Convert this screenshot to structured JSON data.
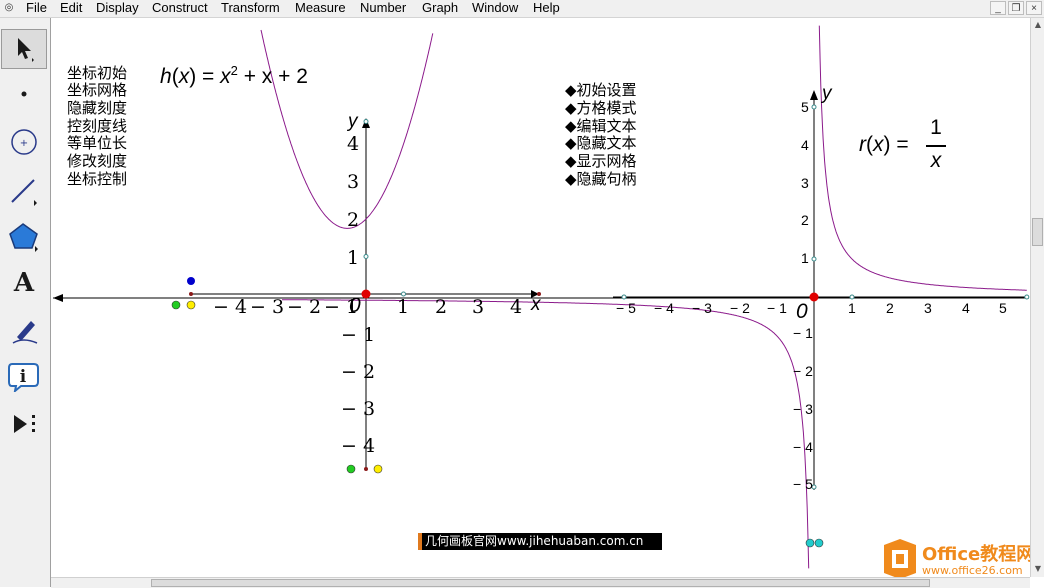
{
  "menu": {
    "items": [
      "File",
      "Edit",
      "Display",
      "Construct",
      "Transform",
      "Measure",
      "Number",
      "Graph",
      "Window",
      "Help"
    ],
    "window_controls": [
      "_",
      "❐",
      "×"
    ]
  },
  "toolbar": {
    "tools": [
      {
        "name": "arrow-select-tool",
        "icon": "arrow-icon",
        "active": true
      },
      {
        "name": "point-tool",
        "icon": "point-icon",
        "active": false
      },
      {
        "name": "compass-tool",
        "icon": "circle-icon",
        "active": false
      },
      {
        "name": "straightedge-tool",
        "icon": "line-icon",
        "active": false
      },
      {
        "name": "polygon-tool",
        "icon": "polygon-icon",
        "active": false
      },
      {
        "name": "text-tool",
        "icon": "text-icon",
        "active": false
      },
      {
        "name": "marker-tool",
        "icon": "pen-icon",
        "active": false
      },
      {
        "name": "information-tool",
        "icon": "info-icon",
        "active": false
      },
      {
        "name": "custom-tool",
        "icon": "custom-tools-icon",
        "active": false
      }
    ],
    "text_tool_glyph": "A"
  },
  "left_commands": [
    "坐标初始",
    "坐标网格",
    "隐藏刻度",
    "控刻度线",
    "等单位长",
    "修改刻度",
    "坐标控制"
  ],
  "middle_commands": [
    "◆初始设置",
    "◆方格模式",
    "◆编辑文本",
    "◆隐藏文本",
    "◆显示网格",
    "◆隐藏句柄"
  ],
  "formula_h": {
    "name": "h",
    "var": "x",
    "sup": "2",
    "rest": " + x + 2"
  },
  "formula_r": {
    "name": "r",
    "var": "x",
    "num": "1",
    "den": "x"
  },
  "banner": {
    "text": "几何画板官网www.jihehuaban.com.cn"
  },
  "watermark": {
    "title": "Office教程网",
    "url": "www.office26.com"
  },
  "graph_left": {
    "x_label": "x",
    "y_label": "y",
    "origin_label": "0",
    "x_ticks": [
      "4",
      "3",
      "2",
      "1",
      "1",
      "2",
      "3",
      "4"
    ],
    "y_ticks": [
      "4",
      "3",
      "2",
      "1",
      "1",
      "2",
      "3",
      "4"
    ],
    "curve_color": "#8b1a8b"
  },
  "graph_right": {
    "x_label": "x",
    "y_label": "y",
    "origin_label": "0",
    "x_ticks": [
      "5",
      "4",
      "3",
      "2",
      "1",
      "1",
      "2",
      "3",
      "4",
      "5"
    ],
    "y_ticks": [
      "5",
      "4",
      "3",
      "2",
      "1",
      "1",
      "2",
      "3",
      "4",
      "5"
    ],
    "curve_color": "#8b1a8b"
  },
  "colors": {
    "point_red": "#e00000",
    "point_green": "#22cc22",
    "point_yellow": "#ffee00",
    "point_blue": "#0000cc",
    "point_cyan": "#22cccc",
    "axis": "#000000"
  }
}
